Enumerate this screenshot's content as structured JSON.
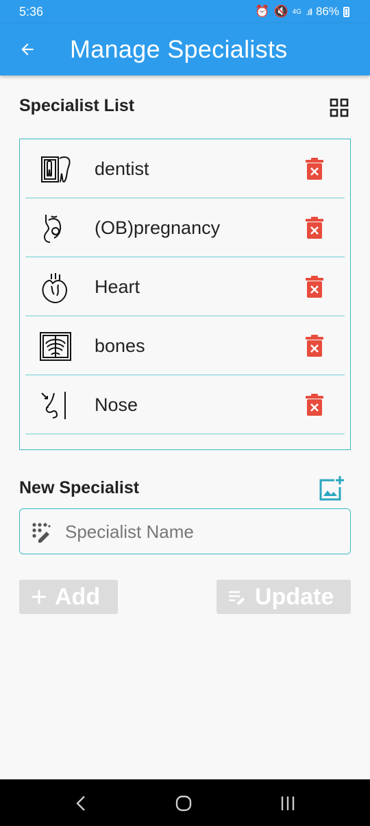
{
  "status_bar": {
    "time": "5:36",
    "network": "4G",
    "signal": ".ıll",
    "battery": "86%"
  },
  "app_bar": {
    "title": "Manage Specialists"
  },
  "specialist_list": {
    "title": "Specialist List",
    "items": [
      {
        "label": "dentist",
        "icon": "tooth-xray-icon"
      },
      {
        "label": "(OB)pregnancy",
        "icon": "pregnancy-icon"
      },
      {
        "label": "Heart",
        "icon": "heart-icon"
      },
      {
        "label": "bones",
        "icon": "skeleton-xray-icon"
      },
      {
        "label": "Nose",
        "icon": "nose-icon"
      }
    ]
  },
  "new_specialist": {
    "title": "New Specialist",
    "input": {
      "placeholder": "Specialist Name",
      "value": ""
    }
  },
  "buttons": {
    "add": "Add",
    "update": "Update"
  },
  "colors": {
    "primary": "#2e9cec",
    "border": "#3bb8c8",
    "delete": "#e84c3d",
    "disabled": "#dcdcdc"
  }
}
